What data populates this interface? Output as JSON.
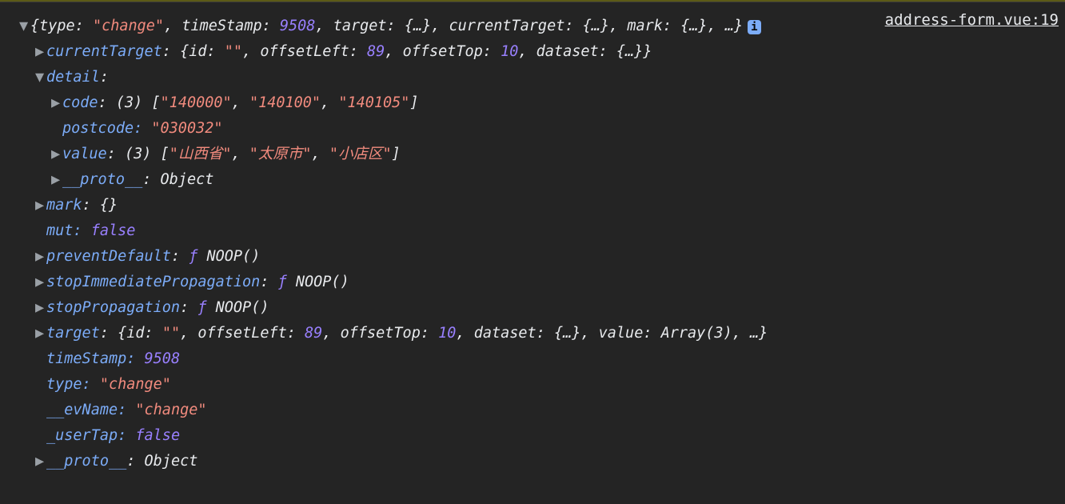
{
  "source_link": "address-form.vue:19",
  "info_badge": "i",
  "summary": {
    "type_key": "type: ",
    "type_val": "\"change\"",
    "ts_key": "timeStamp: ",
    "ts_val": "9508",
    "target_key": "target: ",
    "target_val": "{…}",
    "ct_key": "currentTarget: ",
    "ct_val": "{…}",
    "mark_key": "mark: ",
    "mark_val": "{…}",
    "more": "…"
  },
  "currentTarget": {
    "key": "currentTarget",
    "id_key": "id: ",
    "id_val": "\"\"",
    "ol_key": "offsetLeft: ",
    "ol_val": "89",
    "ot_key": "offsetTop: ",
    "ot_val": "10",
    "ds_key": "dataset: ",
    "ds_val": "{…}"
  },
  "detail": {
    "key": "detail",
    "code_key": "code",
    "code_len": "(3) ",
    "code_v0": "\"140000\"",
    "code_v1": "\"140100\"",
    "code_v2": "\"140105\"",
    "postcode_key": "postcode: ",
    "postcode_val": "\"030032\"",
    "value_key": "value",
    "value_len": "(3) ",
    "value_v0": "\"山西省\"",
    "value_v1": "\"太原市\"",
    "value_v2": "\"小店区\"",
    "proto_key": "__proto__",
    "proto_val": "Object"
  },
  "mark": {
    "key": "mark",
    "val": "{}"
  },
  "mut": {
    "key": "mut: ",
    "val": "false"
  },
  "preventDefault": {
    "key": "preventDefault",
    "f": "ƒ",
    "name": "NOOP()"
  },
  "stopImmediate": {
    "key": "stopImmediatePropagation",
    "f": "ƒ",
    "name": "NOOP()"
  },
  "stopPropagation": {
    "key": "stopPropagation",
    "f": "ƒ",
    "name": "NOOP()"
  },
  "target": {
    "key": "target",
    "id_key": "id: ",
    "id_val": "\"\"",
    "ol_key": "offsetLeft: ",
    "ol_val": "89",
    "ot_key": "offsetTop: ",
    "ot_val": "10",
    "ds_key": "dataset: ",
    "ds_val": "{…}",
    "val_key": "value: ",
    "val_val": "Array(3)",
    "more": "…"
  },
  "timeStamp": {
    "key": "timeStamp: ",
    "val": "9508"
  },
  "type": {
    "key": "type: ",
    "val": "\"change\""
  },
  "evName": {
    "key": "__evName: ",
    "val": "\"change\""
  },
  "userTap": {
    "key": "_userTap: ",
    "val": "false"
  },
  "proto": {
    "key": "__proto__",
    "val": "Object"
  },
  "glyph": {
    "down": "▼",
    "right": "▶",
    "none": " "
  }
}
